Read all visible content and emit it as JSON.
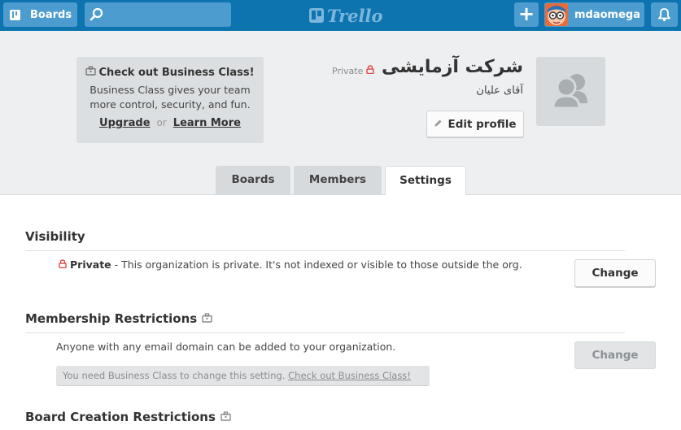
{
  "header": {
    "boards_label": "Boards",
    "logo_text": "Trello",
    "username": "mdaomega",
    "add_label": "+"
  },
  "promo": {
    "title": "Check out Business Class!",
    "text_line1": "Business Class gives your team",
    "text_line2": "more control, security, and fun.",
    "upgrade_label": "Upgrade",
    "or_label": "or",
    "learn_more_label": "Learn More"
  },
  "org": {
    "visibility_badge": "Private",
    "name": "شرکت آزمایشی",
    "subtitle": "آقای علیان",
    "edit_profile_label": "Edit profile"
  },
  "tabs": [
    {
      "label": "Boards",
      "active": false
    },
    {
      "label": "Members",
      "active": false
    },
    {
      "label": "Settings",
      "active": true
    }
  ],
  "settings": {
    "visibility": {
      "title": "Visibility",
      "status": "Private",
      "description": " - This organization is private. It's not indexed or visible to those outside the org.",
      "change_label": "Change"
    },
    "membership": {
      "title": "Membership Restrictions",
      "description": "Anyone with any email domain can be added to your organization.",
      "change_label": "Change",
      "notice_text": "You need Business Class to change this setting.",
      "notice_link": "Check out Business Class!"
    },
    "board_creation": {
      "title": "Board Creation Restrictions"
    }
  },
  "colors": {
    "header_bg": "#0e74af",
    "header_button_bg": "#4d9ccf",
    "lock_red": "#e04b4b"
  }
}
